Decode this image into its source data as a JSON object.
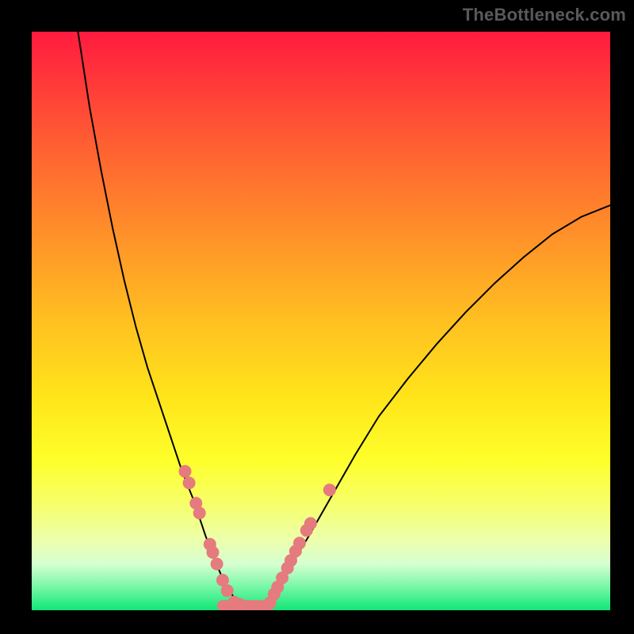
{
  "watermark": "TheBottleneck.com",
  "colors": {
    "dot": "#e57b7e",
    "curve": "#000000"
  },
  "chart_data": {
    "type": "line",
    "title": "",
    "xlabel": "",
    "ylabel": "",
    "xlim": [
      0,
      100
    ],
    "ylim": [
      0,
      100
    ],
    "grid": false,
    "legend": false,
    "series": [
      {
        "name": "curve-left",
        "x": [
          8,
          10,
          12,
          14,
          16,
          18,
          20,
          22,
          24,
          26,
          28,
          30,
          31.5,
          33,
          34.5,
          35.5
        ],
        "values": [
          100,
          87,
          76,
          66,
          57,
          49,
          42,
          36,
          30,
          24,
          19,
          13,
          9,
          5.5,
          3,
          1
        ]
      },
      {
        "name": "curve-right",
        "x": [
          41,
          43,
          45,
          48,
          52,
          56,
          60,
          65,
          70,
          75,
          80,
          85,
          90,
          95,
          100
        ],
        "values": [
          1,
          4,
          8,
          13,
          20,
          27,
          33.5,
          40,
          46,
          51.5,
          56.5,
          61,
          65,
          68,
          70
        ]
      },
      {
        "name": "bottom-segment",
        "x": [
          33,
          41
        ],
        "values": [
          0.8,
          0.8
        ]
      }
    ],
    "marker_groups": [
      {
        "name": "dots-left",
        "points": [
          {
            "x": 26.5,
            "y": 24
          },
          {
            "x": 27.2,
            "y": 22
          },
          {
            "x": 28.4,
            "y": 18.5
          },
          {
            "x": 29.0,
            "y": 16.8
          },
          {
            "x": 30.8,
            "y": 11.4
          },
          {
            "x": 31.3,
            "y": 10
          },
          {
            "x": 32.0,
            "y": 8
          },
          {
            "x": 33.0,
            "y": 5.2
          },
          {
            "x": 33.8,
            "y": 3.4
          },
          {
            "x": 35.0,
            "y": 1.4
          },
          {
            "x": 36.0,
            "y": 1.0
          }
        ]
      },
      {
        "name": "dots-right",
        "points": [
          {
            "x": 41.2,
            "y": 1.3
          },
          {
            "x": 41.9,
            "y": 2.8
          },
          {
            "x": 42.5,
            "y": 4.0
          },
          {
            "x": 43.3,
            "y": 5.6
          },
          {
            "x": 44.2,
            "y": 7.3
          },
          {
            "x": 44.8,
            "y": 8.6
          },
          {
            "x": 45.6,
            "y": 10.2
          },
          {
            "x": 46.3,
            "y": 11.6
          },
          {
            "x": 47.5,
            "y": 13.8
          },
          {
            "x": 48.2,
            "y": 15.0
          },
          {
            "x": 51.5,
            "y": 20.8
          }
        ]
      }
    ]
  }
}
